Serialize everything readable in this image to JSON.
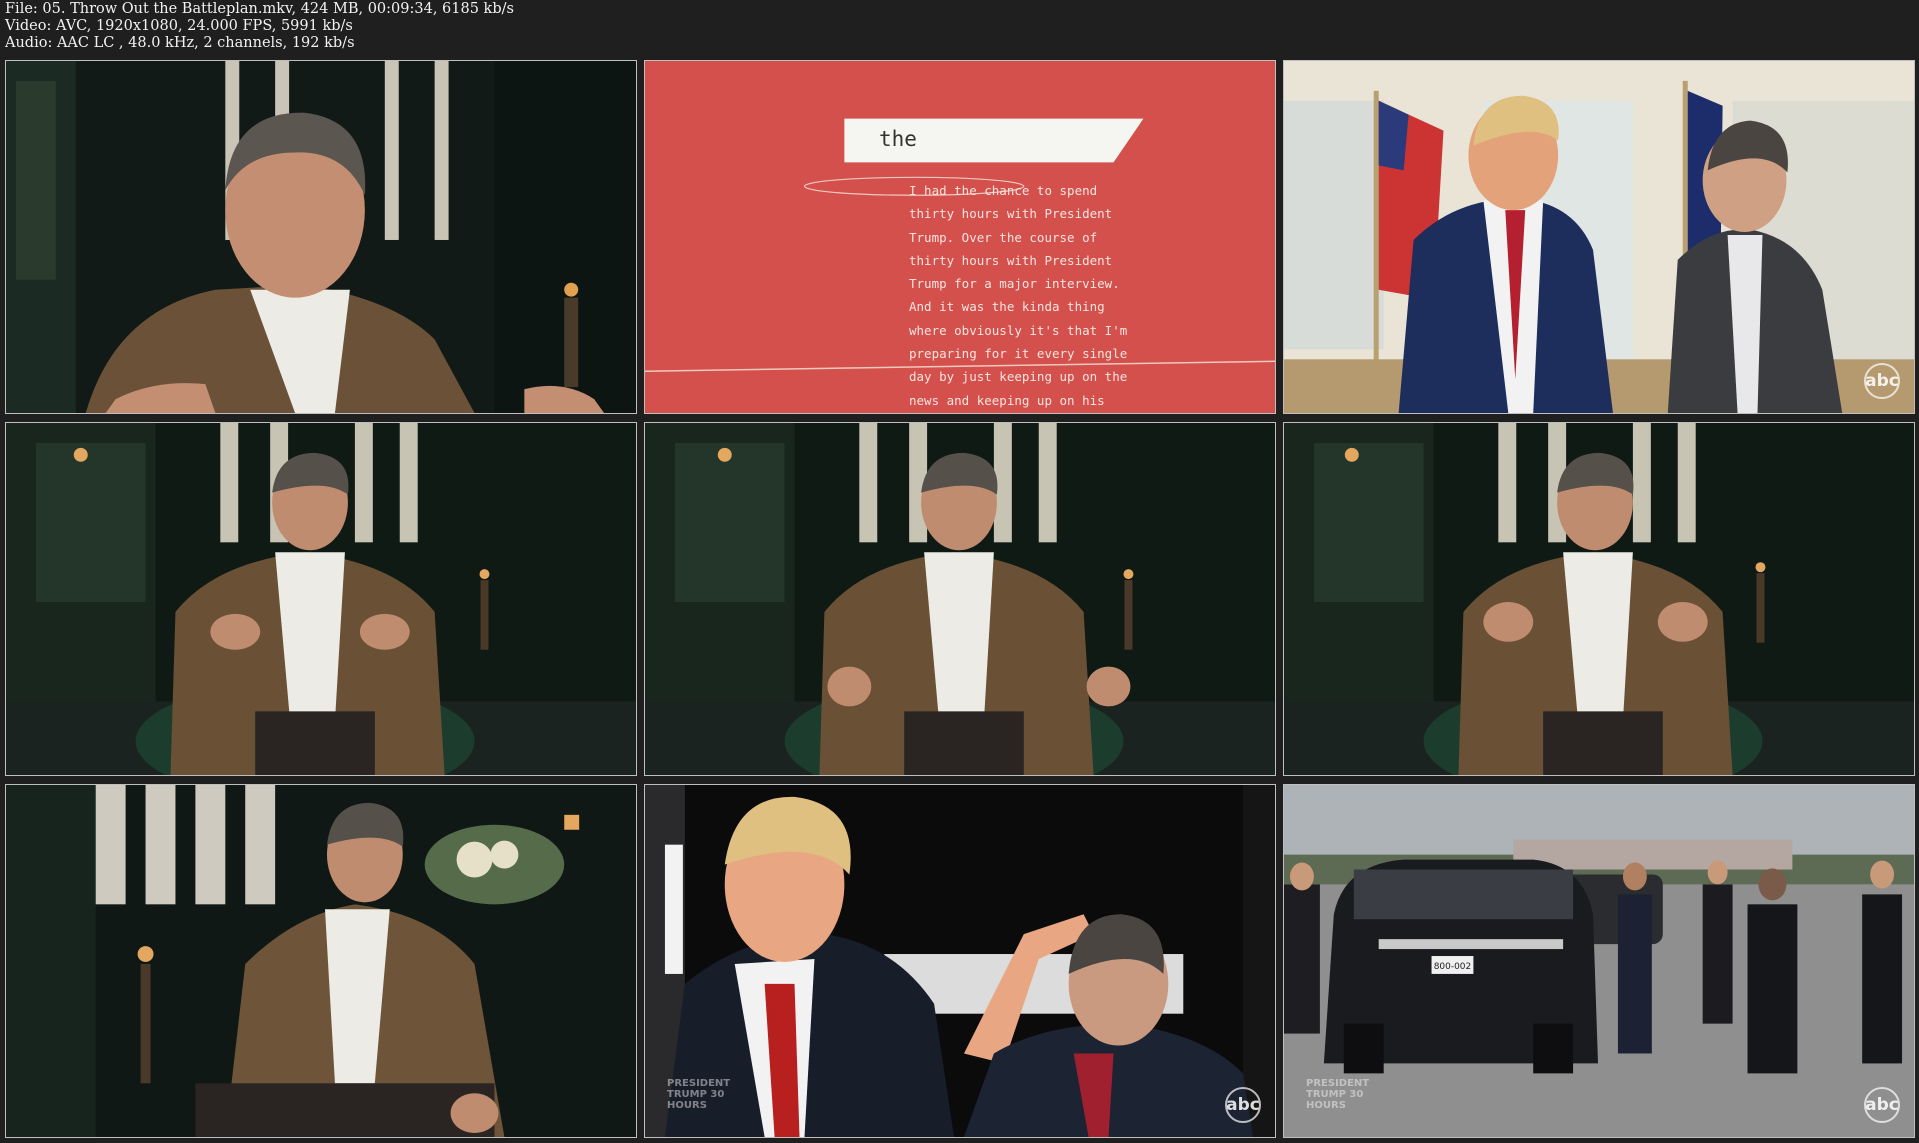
{
  "header": {
    "line1": "File: 05. Throw Out the Battleplan.mkv, 424 MB, 00:09:34, 6185 kb/s",
    "line2": "Video: AVC, 1920x1080, 24.000 FPS, 5991 kb/s",
    "line3": "Audio: AAC LC , 48.0 kHz, 2 channels, 192 kb/s"
  },
  "thumbnails": [
    {
      "scene": "interview-closeup"
    },
    {
      "scene": "title-card",
      "title": "the",
      "lines": [
        "I had the chance to spend",
        "thirty hours with President",
        "Trump. Over the course of",
        "thirty hours with President",
        "Trump for a major interview.",
        "And it was the kinda thing",
        "where obviously it's that I'm",
        "preparing for it every single",
        "day by just keeping up on the",
        "news and keeping up on his"
      ]
    },
    {
      "scene": "oval-office",
      "logo": "abc"
    },
    {
      "scene": "interview-wide"
    },
    {
      "scene": "interview-wide"
    },
    {
      "scene": "interview-wide"
    },
    {
      "scene": "interview-side"
    },
    {
      "scene": "limousine",
      "logo": "abc",
      "bug": "PRESIDENT TRUMP 30 HOURS"
    },
    {
      "scene": "motorcade",
      "logo": "abc",
      "bug": "PRESIDENT TRUMP 30 HOURS",
      "plate": "800-002"
    }
  ],
  "colors": {
    "background": "#1f1f1f",
    "title_red": "#d4504c"
  }
}
